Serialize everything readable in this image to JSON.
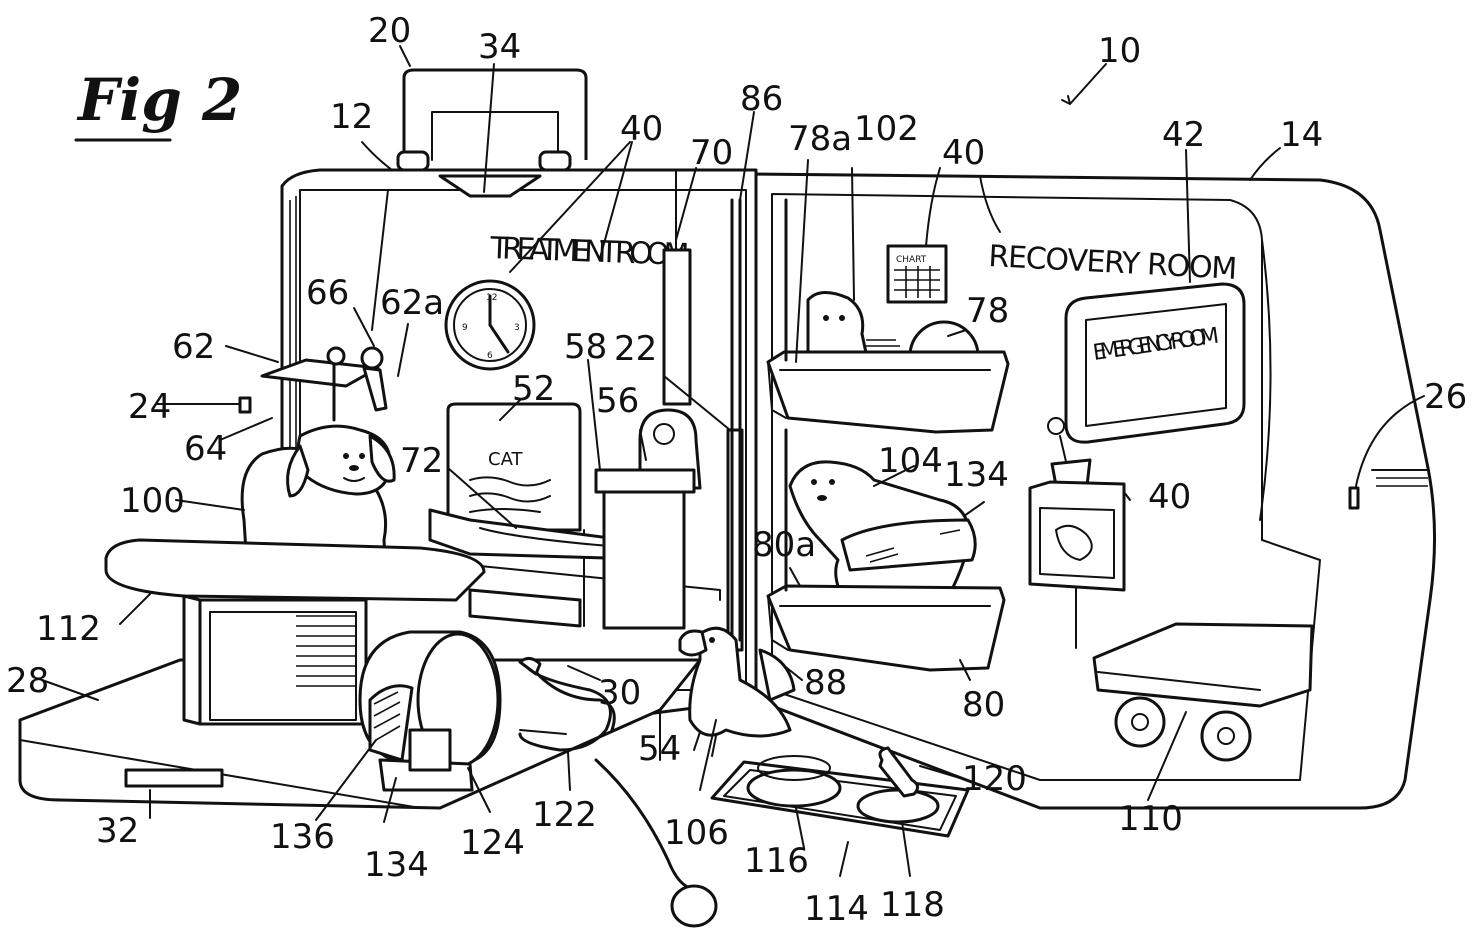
{
  "figure": {
    "label": "Fig 2",
    "signs": {
      "treatment_room": "TREATMENT ROOM",
      "recovery_room": "RECOVERY ROOM",
      "emergency_room": "EMERGENCY ROOM",
      "chart": "CHART",
      "cat_board": "CAT"
    },
    "reference_numerals": [
      "10",
      "12",
      "14",
      "20",
      "22",
      "24",
      "26",
      "28",
      "30",
      "32",
      "34",
      "40",
      "40",
      "40",
      "40",
      "42",
      "52",
      "54",
      "56",
      "58",
      "62",
      "62a",
      "64",
      "66",
      "70",
      "72",
      "78",
      "78a",
      "80",
      "80a",
      "86",
      "88",
      "100",
      "102",
      "104",
      "106",
      "110",
      "112",
      "114",
      "116",
      "118",
      "120",
      "122",
      "124",
      "134",
      "134",
      "136"
    ]
  }
}
